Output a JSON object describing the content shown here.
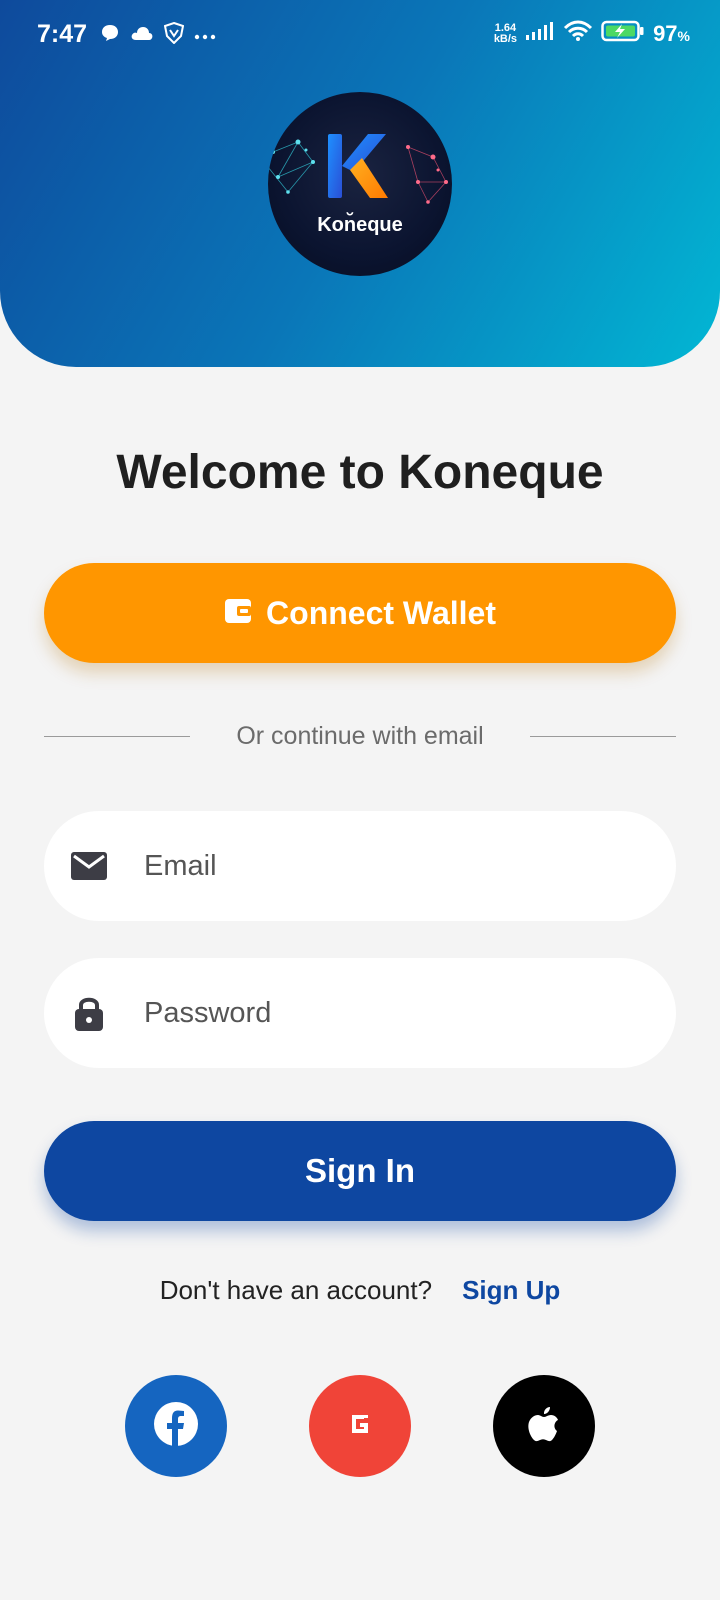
{
  "status_bar": {
    "time": "7:47",
    "net_speed_value": "1.64",
    "net_speed_unit": "kB/s",
    "battery": "97",
    "battery_unit": "%",
    "left_icons": [
      "chat-bubble-icon",
      "cloud-icon",
      "vpn-shield-icon",
      "more-dots-icon"
    ],
    "right_icons": [
      "signal-icon",
      "wifi-icon",
      "battery-charging-icon"
    ]
  },
  "logo": {
    "text": "Kon̆eque"
  },
  "welcome_title": "Welcome to Koneque",
  "connect_wallet": {
    "label": "Connect Wallet",
    "icon": "wallet-icon",
    "color": "#ff9600"
  },
  "divider_text": "Or continue with email",
  "email_field": {
    "placeholder": "Email",
    "icon": "mail-icon"
  },
  "password_field": {
    "placeholder": "Password",
    "icon": "lock-icon"
  },
  "sign_in": {
    "label": "Sign In",
    "color": "#0e47a1"
  },
  "account_prompt": {
    "question": "Don't have an account?",
    "link": "Sign Up"
  },
  "social_buttons": [
    {
      "name": "facebook",
      "icon": "facebook-icon",
      "color": "#1565c0"
    },
    {
      "name": "google",
      "icon": "google-icon",
      "color": "#f04438"
    },
    {
      "name": "apple",
      "icon": "apple-icon",
      "color": "#000000"
    }
  ],
  "colors": {
    "header_gradient_start": "#0e4a9c",
    "header_gradient_end": "#02b7d4",
    "background": "#f4f4f4"
  }
}
